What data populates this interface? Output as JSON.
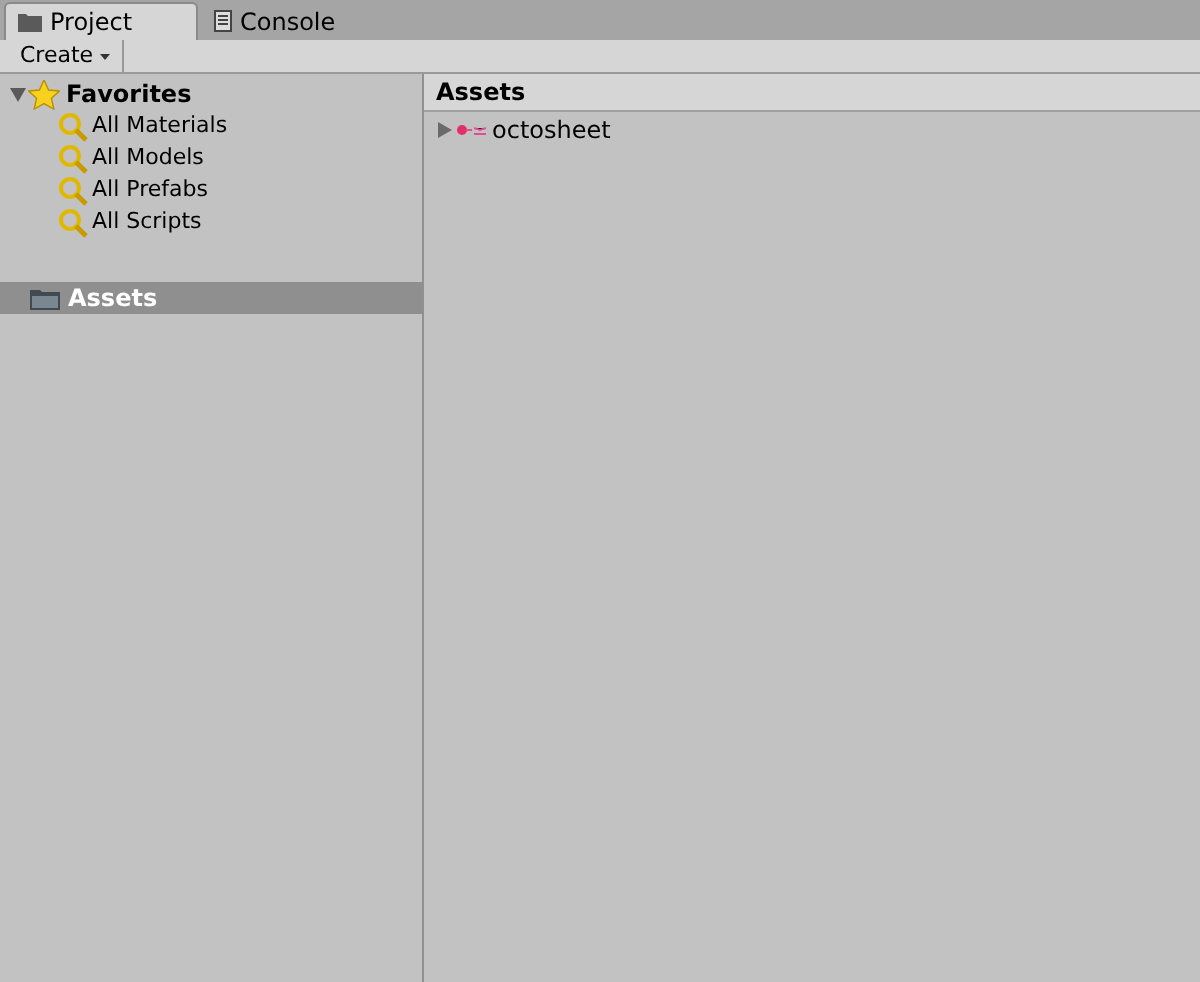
{
  "tabs": [
    {
      "label": "Project",
      "kind": "folder",
      "selected": true
    },
    {
      "label": "Console",
      "kind": "console",
      "selected": false
    }
  ],
  "toolbar": {
    "create_button": "Create"
  },
  "sidebar": {
    "favorites": {
      "label": "Favorites",
      "expanded": true,
      "children": [
        {
          "label": "All Materials"
        },
        {
          "label": "All Models"
        },
        {
          "label": "All Prefabs"
        },
        {
          "label": "All Scripts"
        }
      ]
    },
    "roots": [
      {
        "label": "Assets",
        "selected": true
      }
    ]
  },
  "content": {
    "header": "Assets",
    "items": [
      {
        "label": "octosheet",
        "expanded": false
      }
    ]
  }
}
